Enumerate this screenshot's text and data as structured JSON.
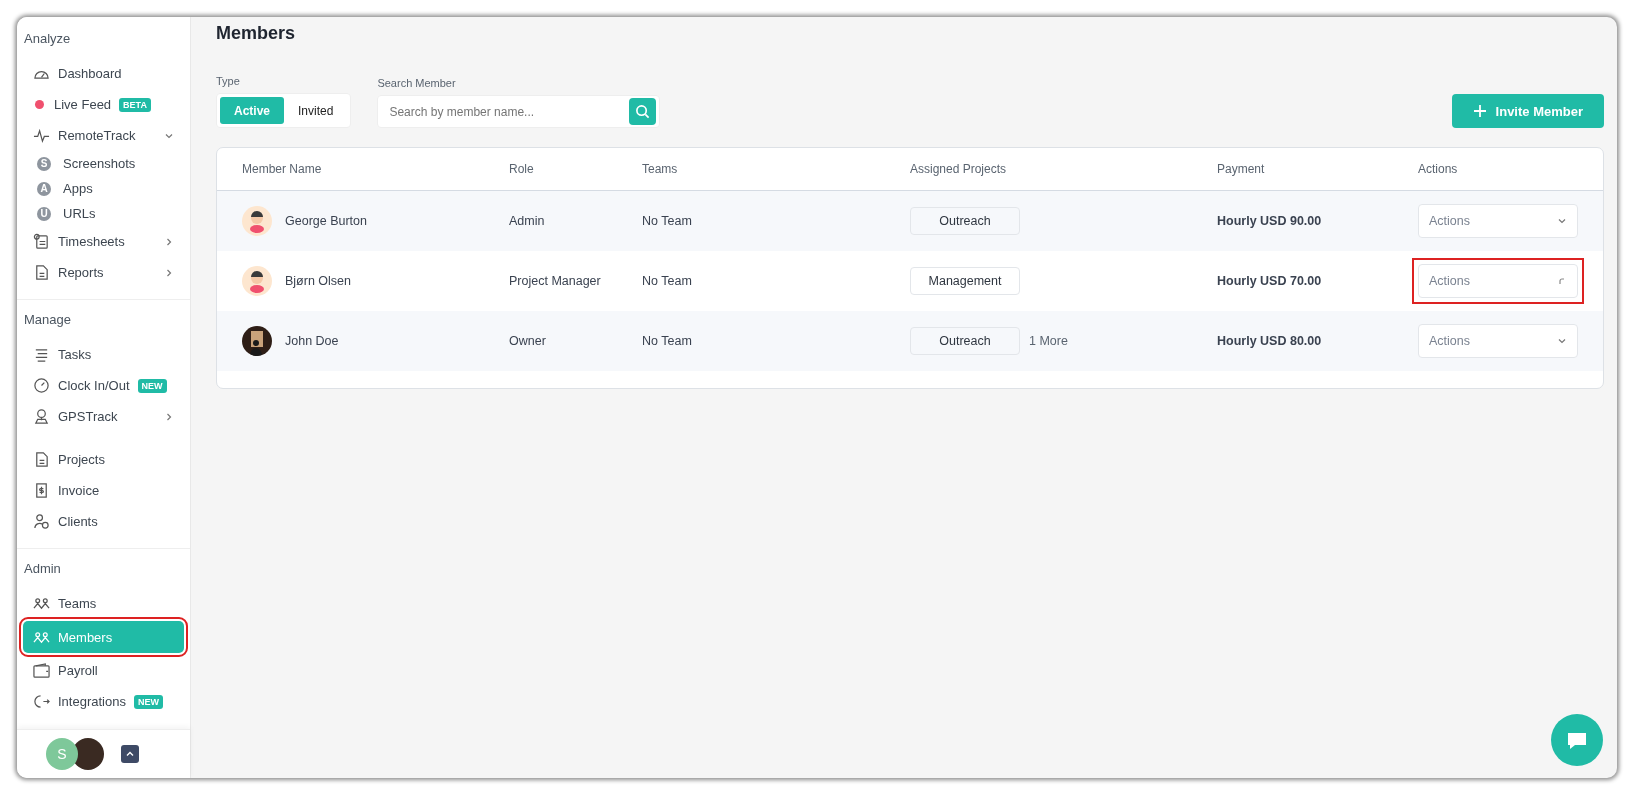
{
  "sidebar": {
    "sections": [
      {
        "title": "Analyze",
        "groups": [
          {
            "items": [
              {
                "label": "Dashboard",
                "kind": "item"
              },
              {
                "label": "Live Feed",
                "kind": "dot",
                "color": "#f0506e",
                "badge": "BETA"
              },
              {
                "label": "RemoteTrack",
                "kind": "item",
                "expanded": true
              },
              {
                "label": "Screenshots",
                "kind": "subitem",
                "letter": "S"
              },
              {
                "label": "Apps",
                "kind": "subitem",
                "letter": "A"
              },
              {
                "label": "URLs",
                "kind": "subitem",
                "letter": "U"
              },
              {
                "label": "Timesheets",
                "kind": "item",
                "expanded": false
              },
              {
                "label": "Reports",
                "kind": "item",
                "expanded": false
              }
            ]
          }
        ]
      },
      {
        "title": "Manage",
        "groups": [
          {
            "items": [
              {
                "label": "Tasks",
                "kind": "item"
              },
              {
                "label": "Clock In/Out",
                "kind": "item",
                "badge": "NEW"
              },
              {
                "label": "GPSTrack",
                "kind": "item",
                "expanded": false
              }
            ]
          },
          {
            "items": [
              {
                "label": "Projects",
                "kind": "item"
              },
              {
                "label": "Invoice",
                "kind": "item"
              },
              {
                "label": "Clients",
                "kind": "item"
              }
            ]
          }
        ]
      },
      {
        "title": "Admin",
        "groups": [
          {
            "items": [
              {
                "label": "Teams",
                "kind": "item",
                "selected": false,
                "highlighted": false
              },
              {
                "label": "Members",
                "kind": "item",
                "selected": true,
                "highlighted": true
              },
              {
                "label": "Payroll",
                "kind": "item",
                "selected": false,
                "highlighted": false
              },
              {
                "label": "Integrations",
                "kind": "item",
                "badge": "NEW",
                "selected": false,
                "highlighted": false
              }
            ]
          }
        ]
      }
    ],
    "footer": {
      "user_initial": "S"
    }
  },
  "page": {
    "title": "Members"
  },
  "filters": {
    "type_label": "Type",
    "types": [
      {
        "label": "Active",
        "selected": true
      },
      {
        "label": "Invited",
        "selected": false
      }
    ],
    "search_label": "Search Member",
    "search": {
      "placeholder": "Search by member name..."
    }
  },
  "invite_button": "Invite Member",
  "table": {
    "columns": [
      "Member Name",
      "Role",
      "Teams",
      "Assigned Projects",
      "Payment",
      "Actions"
    ],
    "rows": [
      {
        "name": "George Burton",
        "kind": "cartoon",
        "role": "Admin",
        "teams": "No Team",
        "projects": [
          "Outreach"
        ],
        "payment": "Hourly USD 90.00",
        "action": "Actions",
        "loading": false,
        "highlighted": false
      },
      {
        "name": "Bjørn Olsen",
        "kind": "cartoon",
        "role": "Project Manager",
        "teams": "No Team",
        "projects": [
          "Management"
        ],
        "payment": "Hourly USD 70.00",
        "action": "Actions",
        "loading": true,
        "highlighted": true
      },
      {
        "name": "John Doe",
        "kind": "photo",
        "role": "Owner",
        "teams": "No Team",
        "projects": [
          "Outreach"
        ],
        "more": "1 More",
        "payment": "Hourly USD 80.00",
        "action": "Actions",
        "loading": false,
        "highlighted": false
      }
    ]
  }
}
